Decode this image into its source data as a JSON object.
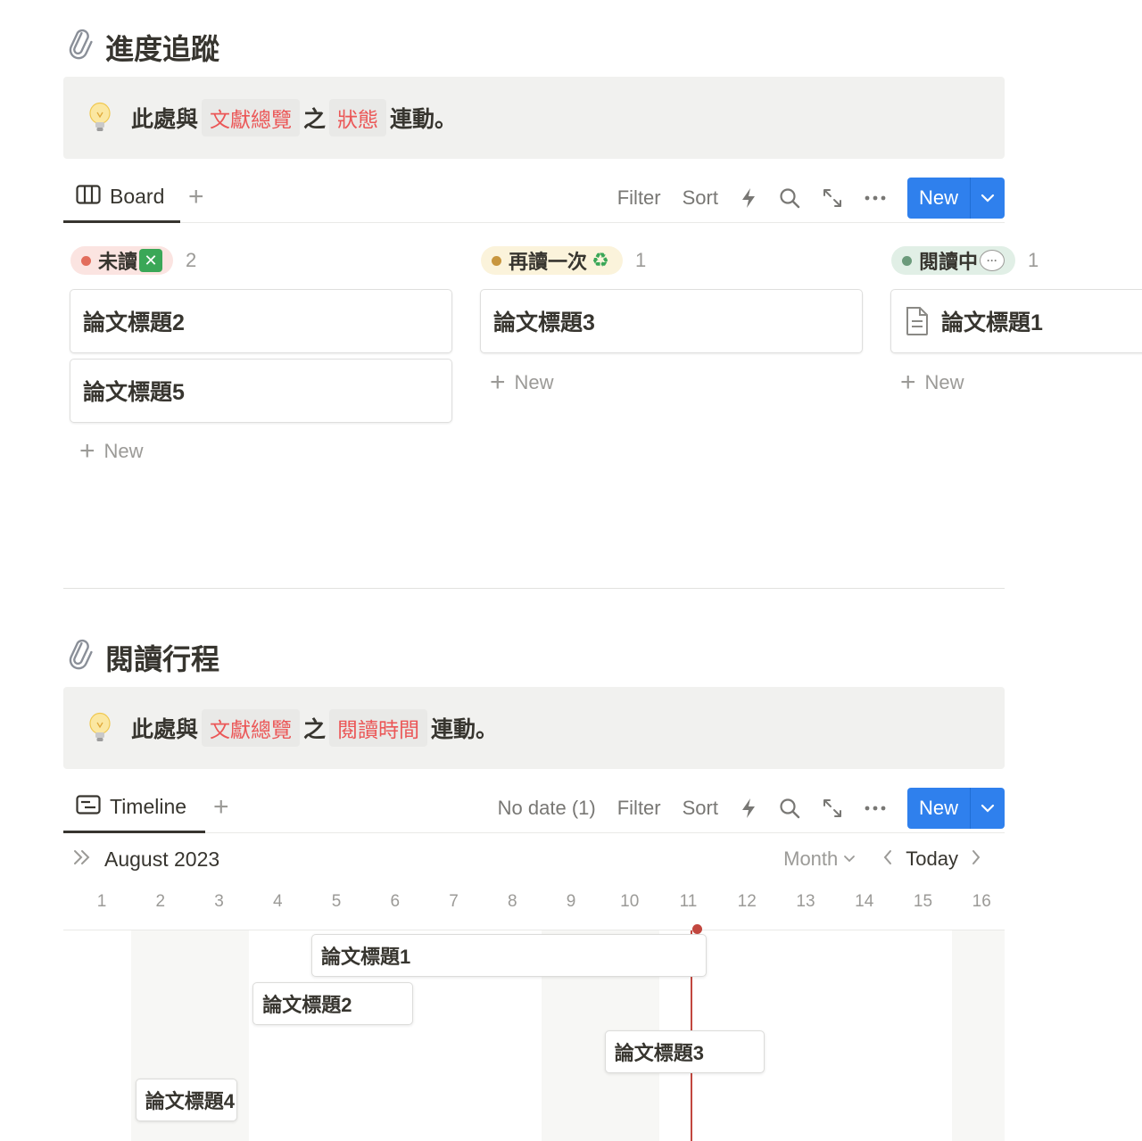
{
  "section1": {
    "heading": "進度追蹤",
    "callout": {
      "prefix": "此處與",
      "tag1": "文獻總覽",
      "middle": "之",
      "tag2": "狀態",
      "suffix": "連動。"
    },
    "view_tab": "Board",
    "toolbar": {
      "filter": "Filter",
      "sort": "Sort",
      "new": "New"
    },
    "columns": [
      {
        "label": "未讀",
        "emoji": "✕",
        "count": "2",
        "color": "#e26d5c",
        "bg": "#fbe4e1",
        "cards": [
          "論文標題2",
          "論文標題5"
        ],
        "new_label": "New"
      },
      {
        "label": "再讀一次",
        "emoji": "♻",
        "count": "1",
        "color": "#c8963e",
        "bg": "#fbf3db",
        "cards": [
          "論文標題3"
        ],
        "new_label": "New"
      },
      {
        "label": "閱讀中",
        "emoji": "···",
        "count": "1",
        "color": "#6b9a7b",
        "bg": "#e1efe6",
        "cards": [
          "論文標題1"
        ],
        "new_label": "New"
      }
    ]
  },
  "section2": {
    "heading": "閱讀行程",
    "callout": {
      "prefix": "此處與",
      "tag1": "文獻總覽",
      "middle": "之",
      "tag2": "閱讀時間",
      "suffix": "連動。"
    },
    "view_tab": "Timeline",
    "toolbar": {
      "no_date": "No date (1)",
      "filter": "Filter",
      "sort": "Sort",
      "new": "New"
    },
    "timeline": {
      "month": "August 2023",
      "scale": "Month",
      "today": "Today",
      "days": [
        "1",
        "2",
        "3",
        "4",
        "5",
        "6",
        "7",
        "8",
        "9",
        "10",
        "11",
        "12",
        "13",
        "14",
        "15",
        "16"
      ],
      "today_day": 11,
      "items": [
        {
          "title": "論文標題1",
          "start": 5,
          "end": 11
        },
        {
          "title": "論文標題2",
          "start": 4,
          "end": 6
        },
        {
          "title": "論文標題3",
          "start": 10,
          "end": 12
        },
        {
          "title": "論文標題4",
          "start": 2,
          "end": 3
        }
      ]
    }
  }
}
